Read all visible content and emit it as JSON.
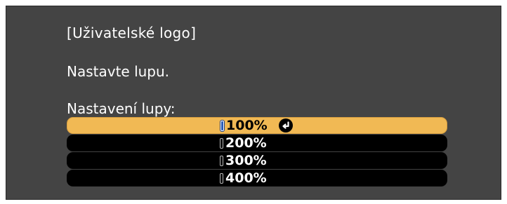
{
  "title": "[Uživatelské logo]",
  "instruction": "Nastavte lupu.",
  "zoom_setting": {
    "label": "Nastavení lupy:",
    "options": [
      {
        "label": "100%",
        "selected": true
      },
      {
        "label": "200%",
        "selected": false
      },
      {
        "label": "300%",
        "selected": false
      },
      {
        "label": "400%",
        "selected": false
      }
    ]
  },
  "icons": {
    "enter": "enter-icon"
  },
  "colors": {
    "background": "#444444",
    "highlight": "#f1b954",
    "option_background": "#000000",
    "text": "#ffffff"
  }
}
